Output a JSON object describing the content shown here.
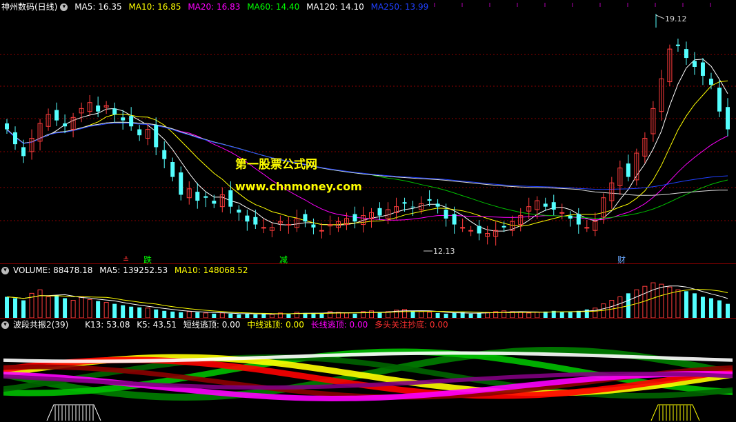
{
  "main_panel": {
    "title": "神州数码(日线)",
    "indicators": [
      {
        "label": "MA5: 16.35",
        "color": "#ffffff"
      },
      {
        "label": "MA10: 16.85",
        "color": "#ffff00"
      },
      {
        "label": "MA20: 16.83",
        "color": "#ff00ff"
      },
      {
        "label": "MA60: 14.40",
        "color": "#00ff00"
      },
      {
        "label": "MA120: 14.10",
        "color": "#ffffff"
      },
      {
        "label": "MA250: 13.99",
        "color": "#0000ff"
      }
    ],
    "high_label": "19.12",
    "low_label": "12.13",
    "watermark_title": "第一股票公式网",
    "watermark_url": "www.chnmoney.com",
    "markers": [
      {
        "text": "跌",
        "color": "#00ff00"
      },
      {
        "text": "减",
        "color": "#00ff00"
      },
      {
        "text": "财",
        "color": "#6aa8ff"
      }
    ]
  },
  "volume_panel": {
    "indicators": [
      {
        "label": "VOLUME: 88478.18",
        "color": "#ffffff"
      },
      {
        "label": "MA5: 139252.53",
        "color": "#ffffff"
      },
      {
        "label": "MA10: 148068.52",
        "color": "#ffff00"
      }
    ]
  },
  "indicator_panel": {
    "title": "波段共振2(39)",
    "indicators": [
      {
        "label": "K13: 53.08",
        "color": "#ffffff"
      },
      {
        "label": "K5: 43.51",
        "color": "#ffffff"
      },
      {
        "label": "短线逃顶: 0.00",
        "color": "#ffffff"
      },
      {
        "label": "中线逃顶: 0.00",
        "color": "#ffff00"
      },
      {
        "label": "长线逃顶: 0.00",
        "color": "#ff00ff"
      },
      {
        "label": "多头关注抄底: 0.00",
        "color": "#ff3030"
      }
    ]
  },
  "chart_data": {
    "type": "candlestick",
    "price_range": [
      11.5,
      19.5
    ],
    "closes": [
      15.8,
      15.3,
      14.9,
      15.5,
      16.0,
      16.3,
      16.1,
      15.9,
      16.2,
      16.5,
      16.7,
      16.4,
      16.6,
      16.3,
      16.1,
      15.9,
      15.6,
      15.8,
      15.2,
      14.8,
      14.2,
      13.6,
      13.8,
      13.4,
      13.5,
      13.3,
      13.6,
      13.2,
      13.0,
      12.7,
      12.6,
      12.5,
      12.5,
      12.7,
      12.6,
      12.8,
      12.7,
      12.5,
      12.4,
      12.6,
      12.7,
      12.8,
      12.7,
      12.9,
      13.0,
      12.9,
      13.1,
      13.2,
      13.3,
      13.2,
      13.3,
      13.4,
      13.2,
      12.8,
      12.6,
      12.5,
      12.4,
      12.3,
      12.3,
      12.4,
      12.5,
      12.7,
      12.9,
      13.2,
      13.4,
      13.2,
      13.1,
      13.0,
      12.8,
      12.6,
      12.5,
      12.7,
      13.5,
      14.0,
      14.5,
      14.2,
      15.0,
      15.5,
      16.5,
      17.5,
      18.5,
      18.6,
      18.2,
      17.9,
      17.6,
      17.3,
      16.4,
      15.8
    ],
    "volumes": [
      30,
      28,
      25,
      35,
      40,
      30,
      32,
      28,
      25,
      30,
      26,
      24,
      22,
      20,
      18,
      16,
      15,
      14,
      12,
      10,
      9,
      8,
      9,
      8,
      7,
      6,
      7,
      6,
      5,
      6,
      5,
      6,
      5,
      7,
      6,
      8,
      7,
      6,
      7,
      9,
      8,
      7,
      6,
      9,
      10,
      8,
      9,
      11,
      12,
      10,
      9,
      8,
      7,
      6,
      7,
      8,
      6,
      7,
      8,
      9,
      10,
      9,
      8,
      7,
      8,
      9,
      10,
      8,
      9,
      10,
      12,
      14,
      20,
      25,
      30,
      35,
      40,
      45,
      50,
      48,
      44,
      40,
      38,
      35,
      30,
      28,
      25,
      20
    ],
    "volume_ma10_label": "148068.52",
    "volume_ma5_label": "139252.53"
  },
  "colors": {
    "up": "#ff3c3c",
    "down": "#54ffff",
    "panel_sep": "#8b0000",
    "ma5": "#ffffff",
    "ma10": "#ffff00",
    "ma20": "#ff00ff",
    "ma60": "#00c000",
    "ma120": "#dddddd",
    "ma250": "#2040ff"
  }
}
